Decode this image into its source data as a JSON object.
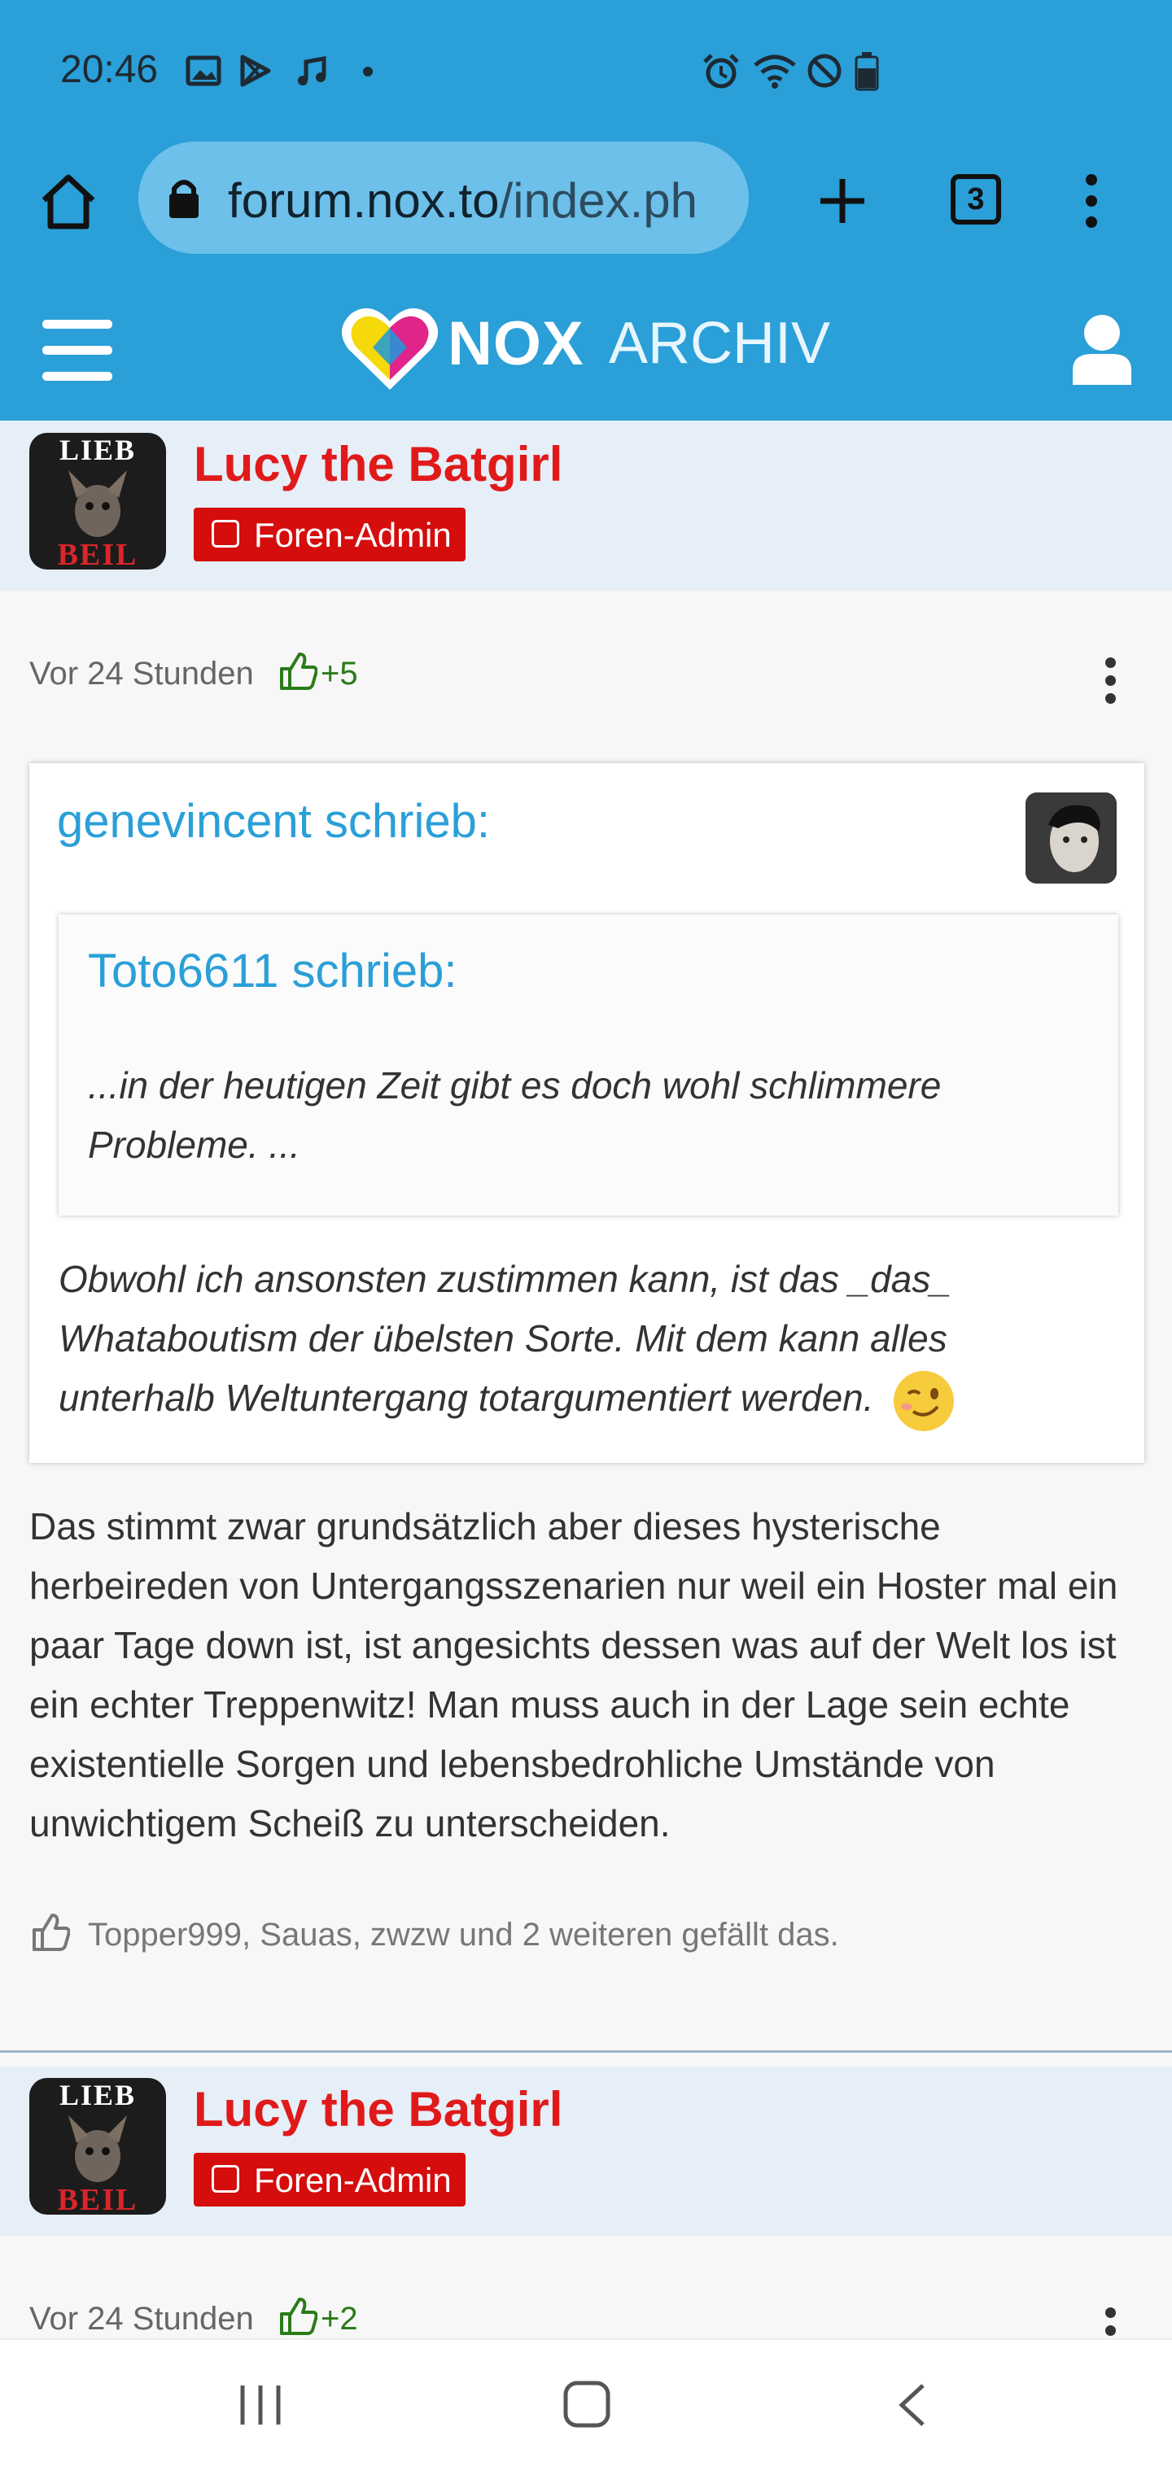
{
  "status_bar": {
    "time": "20:46",
    "icons_left": [
      "image-icon",
      "play-store-icon",
      "music-icon",
      "dot-icon"
    ],
    "icons_right": [
      "alarm-icon",
      "wifi-icon",
      "do-not-disturb-icon",
      "battery-icon"
    ]
  },
  "browser": {
    "url_main": "forum.nox.to",
    "url_path": "/index.ph",
    "tab_count": "3"
  },
  "forum_header": {
    "logo_bold": "NOX",
    "logo_light": "ARCHIV"
  },
  "posts": [
    {
      "author": "Lucy the Batgirl",
      "rank": "Foren-Admin",
      "avatar_top_text": "LIEB",
      "avatar_bottom_text": "BEIL",
      "time": "Vor 24 Stunden",
      "likes": "+5",
      "quote": {
        "author": "genevincent schrieb:",
        "nested": {
          "author": "Toto6611 schrieb:",
          "text": "...in der heutigen Zeit gibt es doch wohl schlimmere Probleme. ..."
        },
        "text": "Obwohl ich ansonsten zustimmen kann, ist das _das_ Whataboutism der übelsten Sorte. Mit dem kann alles unterhalb Weltuntergang totargumentiert werden."
      },
      "body": "Das stimmt zwar grundsätzlich aber dieses hysterische herbeireden von Untergangsszenarien nur weil ein Hoster mal ein paar Tage down ist, ist angesichts dessen was auf der Welt los ist ein echter Treppenwitz! Man muss auch in der Lage sein echte existentielle Sorgen und lebensbedrohliche Umstände von unwichtigem Scheiß zu unterscheiden.",
      "likers": "Topper999, Sauas, zwzw und 2 weiteren gefällt das."
    },
    {
      "author": "Lucy the Batgirl",
      "rank": "Foren-Admin",
      "avatar_top_text": "LIEB",
      "avatar_bottom_text": "BEIL",
      "time": "Vor 24 Stunden",
      "likes": "+2"
    }
  ],
  "colors": {
    "header_blue": "#2a9fd8",
    "author_red": "#e01a1a",
    "rank_red": "#d50d0d",
    "like_green": "#2a7b19",
    "quote_author_blue": "#2a9fd8"
  }
}
